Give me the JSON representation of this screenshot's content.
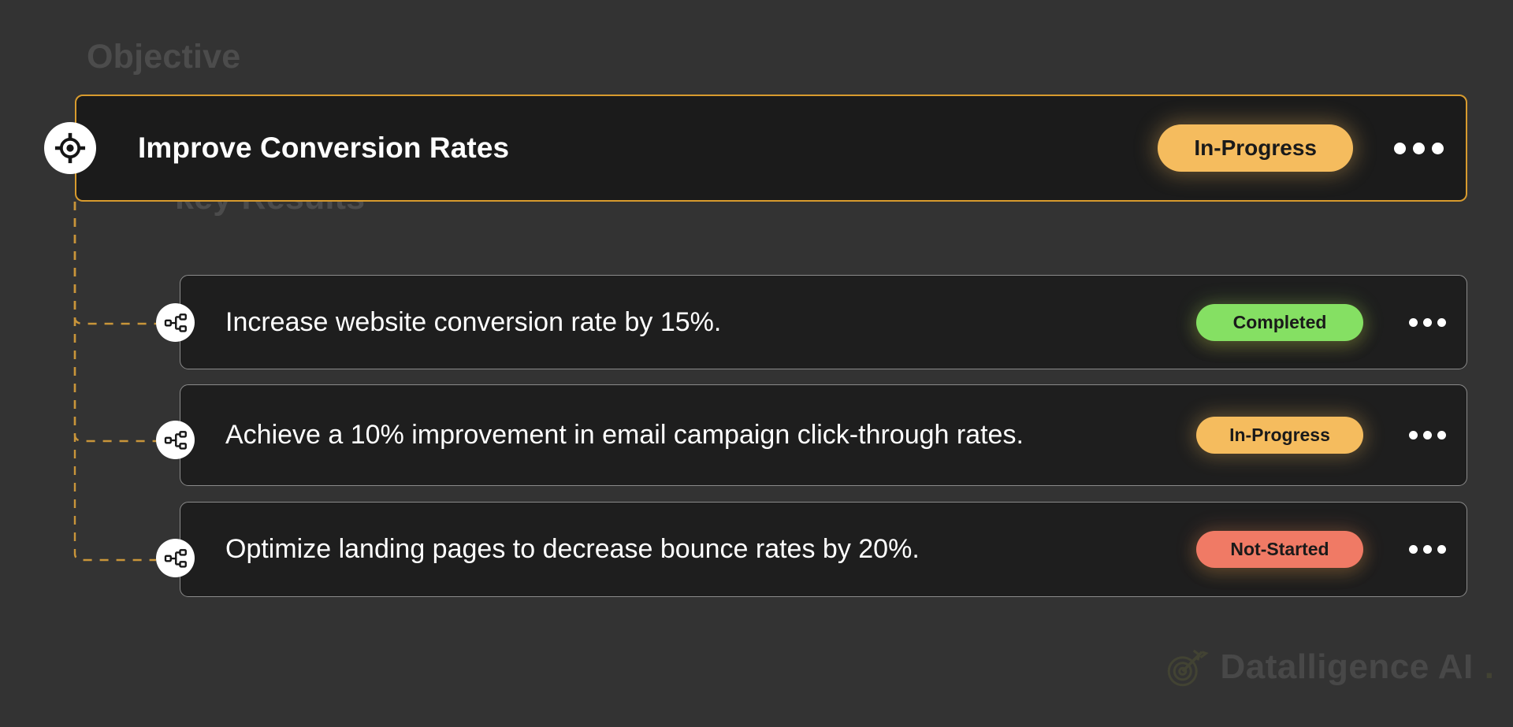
{
  "theme": {
    "page_background": "#333333",
    "card_background": "#1C1C1C",
    "objective_border": "#D89B2E",
    "keyresult_border": "#8B8B8B",
    "section_label_color": "#4C4C4C",
    "connector_color": "#C9953A",
    "text_primary": "#FFFFFF",
    "badge_in_progress": "#F5BC5E",
    "badge_completed": "#85E063",
    "badge_not_started": "#F07A65",
    "badge_text": "#1A1A1A"
  },
  "sections": {
    "objective_label": "Objective",
    "key_results_label": "key Results"
  },
  "objective": {
    "icon": "target-crosshair-icon",
    "title": "Improve Conversion Rates",
    "status": "In-Progress",
    "status_color": "#F5BC5E",
    "menu": "more-options"
  },
  "key_results": [
    {
      "icon": "hierarchy-icon",
      "text": "Increase website conversion rate by 15%.",
      "status": "Completed",
      "status_color": "#85E063",
      "menu": "more-options"
    },
    {
      "icon": "hierarchy-icon",
      "text": "Achieve a 10% improvement in email campaign click-through rates.",
      "status": "In-Progress",
      "status_color": "#F5BC5E",
      "menu": "more-options"
    },
    {
      "icon": "hierarchy-icon",
      "text": "Optimize landing pages to decrease bounce rates by 20%.",
      "status": "Not-Started",
      "status_color": "#F07A65",
      "menu": "more-options"
    }
  ],
  "watermark": {
    "brand": "Datalligence AI",
    "dot": ".",
    "logo": "target-arrow-logo"
  }
}
